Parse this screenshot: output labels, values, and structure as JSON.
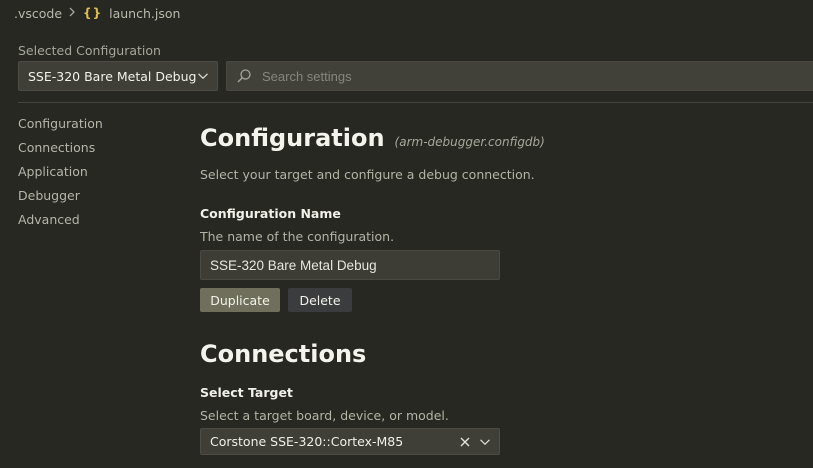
{
  "breadcrumb": {
    "folder": ".vscode",
    "file_icon": "{}",
    "file": "launch.json"
  },
  "selected_configuration": {
    "label": "Selected Configuration",
    "value": "SSE-320 Bare Metal Debug"
  },
  "search": {
    "placeholder": "Search settings",
    "value": ""
  },
  "nav": {
    "items": [
      {
        "label": "Configuration"
      },
      {
        "label": "Connections"
      },
      {
        "label": "Application"
      },
      {
        "label": "Debugger"
      },
      {
        "label": "Advanced"
      }
    ]
  },
  "configuration_section": {
    "title": "Configuration",
    "subtitle": "(arm-debugger.configdb)",
    "description": "Select your target and configure a debug connection.",
    "name_field": {
      "label": "Configuration Name",
      "description": "The name of the configuration.",
      "value": "SSE-320 Bare Metal Debug"
    },
    "duplicate_label": "Duplicate",
    "delete_label": "Delete"
  },
  "connections_section": {
    "title": "Connections",
    "target_field": {
      "label": "Select Target",
      "description": "Select a target board, device, or model.",
      "value": "Corstone SSE-320::Cortex-M85"
    }
  },
  "icons": {
    "breadcrumb_separator": "chevron-right-icon",
    "search": "search-icon",
    "dropdown": "chevron-down-icon",
    "clear": "close-icon"
  },
  "colors": {
    "background": "#272822",
    "primary_button": "#6f6f5c",
    "secondary_button": "#3a3c3d",
    "json_icon": "#e2c04a"
  }
}
